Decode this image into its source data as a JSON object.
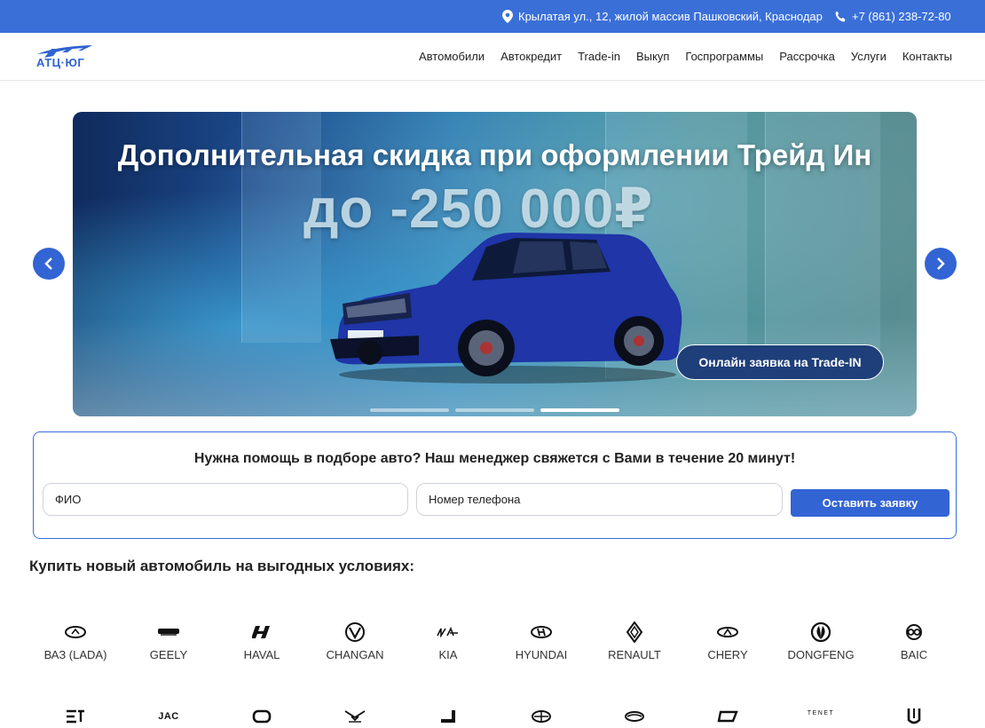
{
  "topbar": {
    "address": "Крылатая ул., 12, жилой массив Пашковский, Краснодар",
    "phone": "+7 (861) 238-72-80",
    "colors": {
      "background": "#3a6fd8"
    }
  },
  "header": {
    "logo_text": "АТЦ·ЮГ",
    "nav": [
      "Автомобили",
      "Автокредит",
      "Trade-in",
      "Выкуп",
      "Госпрограммы",
      "Рассрочка",
      "Услуги",
      "Контакты"
    ]
  },
  "slider": {
    "headline": "Дополнительная скидка при оформлении Трейд Ин",
    "discount": "до -250 000₽",
    "cta_label": "Онлайн заявка на Trade-IN",
    "dots_count": 3,
    "active_dot": 3
  },
  "callback": {
    "title": "Нужна помощь в подборе авто? Наш менеджер свяжется с Вами в течение 20 минут!",
    "name_placeholder": "ФИО",
    "phone_placeholder": "Номер телефона",
    "submit_label": "Оставить заявку"
  },
  "brands": {
    "title": "Купить новый автомобиль на выгодных условиях:",
    "row1": [
      {
        "name": "ВАЗ (LADA)",
        "icon": "lada-logo-icon"
      },
      {
        "name": "GEELY",
        "icon": "geely-logo-icon"
      },
      {
        "name": "HAVAL",
        "icon": "haval-logo-icon"
      },
      {
        "name": "CHANGAN",
        "icon": "changan-logo-icon"
      },
      {
        "name": "KIA",
        "icon": "kia-logo-icon"
      },
      {
        "name": "HYUNDAI",
        "icon": "hyundai-logo-icon"
      },
      {
        "name": "RENAULT",
        "icon": "renault-logo-icon"
      },
      {
        "name": "CHERY",
        "icon": "chery-logo-icon"
      },
      {
        "name": "DONGFENG",
        "icon": "dongfeng-logo-icon"
      },
      {
        "name": "BAIC",
        "icon": "baic-logo-icon"
      }
    ],
    "row2": [
      {
        "icon": "exeed-logo-icon"
      },
      {
        "icon": "jac-logo-icon",
        "text": "JAC"
      },
      {
        "icon": "omoda-logo-icon"
      },
      {
        "icon": "kaiyi-logo-icon"
      },
      {
        "icon": "jetour-logo-icon"
      },
      {
        "icon": "gac-logo-icon"
      },
      {
        "icon": "solaris-logo-icon"
      },
      {
        "icon": "livan-logo-icon"
      },
      {
        "icon": "tenet-logo-icon",
        "text": "TENET"
      },
      {
        "icon": "jaecoo-logo-icon"
      }
    ]
  },
  "colors": {
    "accent": "#3364d4",
    "border": "#3a6fd8"
  }
}
